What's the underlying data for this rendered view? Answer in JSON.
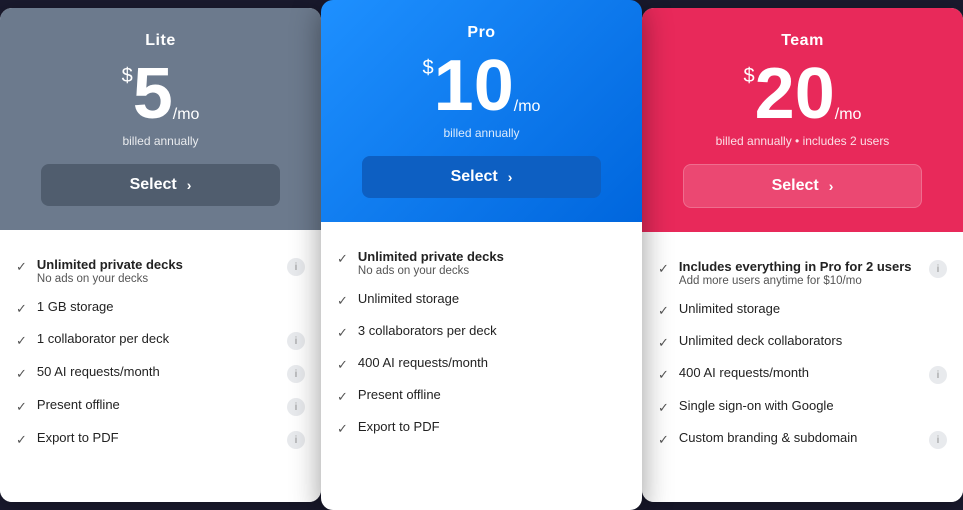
{
  "plans": [
    {
      "id": "lite",
      "name": "Lite",
      "price": "5",
      "billing": "billed annually",
      "select_label": "Select",
      "header_class": "lite-header",
      "btn_class": "lite-btn",
      "features": [
        {
          "text": "Unlimited private decks",
          "sub": "No ads on your decks",
          "bold": true,
          "info": true
        },
        {
          "text": "1 GB storage",
          "sub": "",
          "bold": false,
          "info": false
        },
        {
          "text": "1 collaborator per deck",
          "sub": "",
          "bold": false,
          "info": true
        },
        {
          "text": "50 AI requests/month",
          "sub": "",
          "bold": false,
          "info": true
        },
        {
          "text": "Present offline",
          "sub": "",
          "bold": false,
          "info": true
        },
        {
          "text": "Export to PDF",
          "sub": "",
          "bold": false,
          "info": true
        }
      ]
    },
    {
      "id": "pro",
      "name": "Pro",
      "price": "10",
      "billing": "billed annually",
      "select_label": "Select",
      "header_class": "pro-header",
      "btn_class": "pro-btn",
      "features": [
        {
          "text": "Unlimited private decks",
          "sub": "No ads on your decks",
          "bold": true,
          "info": false
        },
        {
          "text": "Unlimited storage",
          "sub": "",
          "bold": false,
          "info": false
        },
        {
          "text": "3 collaborators per deck",
          "sub": "",
          "bold": false,
          "info": false
        },
        {
          "text": "400 AI requests/month",
          "sub": "",
          "bold": false,
          "info": false
        },
        {
          "text": "Present offline",
          "sub": "",
          "bold": false,
          "info": false
        },
        {
          "text": "Export to PDF",
          "sub": "",
          "bold": false,
          "info": false
        }
      ]
    },
    {
      "id": "team",
      "name": "Team",
      "price": "20",
      "billing": "billed annually • includes 2 users",
      "select_label": "Select",
      "header_class": "team-header",
      "btn_class": "team-btn",
      "features": [
        {
          "text": "Includes everything in Pro for 2 users",
          "sub": "Add more users anytime for $10/mo",
          "bold": true,
          "info": true
        },
        {
          "text": "Unlimited storage",
          "sub": "",
          "bold": false,
          "info": false
        },
        {
          "text": "Unlimited deck collaborators",
          "sub": "",
          "bold": false,
          "info": false
        },
        {
          "text": "400 AI requests/month",
          "sub": "",
          "bold": false,
          "info": true
        },
        {
          "text": "Single sign-on with Google",
          "sub": "",
          "bold": false,
          "info": false
        },
        {
          "text": "Custom branding & subdomain",
          "sub": "",
          "bold": false,
          "info": true
        }
      ]
    }
  ],
  "chevron": "›",
  "info_icon": "i"
}
